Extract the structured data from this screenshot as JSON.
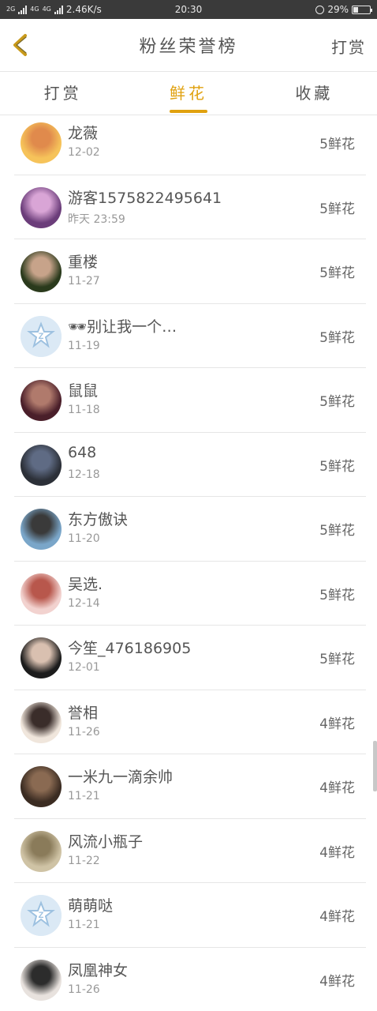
{
  "status_bar": {
    "net1": "2G",
    "net2": "4G",
    "net3": "4G",
    "speed": "2.46K/s",
    "time": "20:30",
    "battery_percent": "29%",
    "battery_level": 0.29
  },
  "header": {
    "title": "粉丝荣誉榜",
    "right_action": "打赏"
  },
  "tabs": [
    {
      "label": "打赏",
      "active": false
    },
    {
      "label": "鲜花",
      "active": true
    },
    {
      "label": "收藏",
      "active": false
    }
  ],
  "fans": [
    {
      "name": "龙薇",
      "time": "12-02",
      "flowers": "5鲜花",
      "avatar": "anime-avatar",
      "colors": [
        "#f6c35a",
        "#e08a4c"
      ]
    },
    {
      "name": "游客15758224956​41",
      "time": "昨天 23:59",
      "flowers": "5鲜花",
      "avatar": "anime-avatar",
      "colors": [
        "#6b3d7a",
        "#d9a5d6"
      ]
    },
    {
      "name": "重楼",
      "time": "11-27",
      "flowers": "5鲜花",
      "avatar": "photo-avatar",
      "colors": [
        "#2a3a1c",
        "#c7a38a"
      ]
    },
    {
      "name": "🕶别让我一个…",
      "time": "11-19",
      "flowers": "5鲜花",
      "avatar": "default-avatar",
      "colors": [
        "#dbe9f5",
        "#9dc1e0"
      ]
    },
    {
      "name": "鼠鼠",
      "time": "11-18",
      "flowers": "5鲜花",
      "avatar": "photo-avatar",
      "colors": [
        "#4a1f2a",
        "#b07a6c"
      ]
    },
    {
      "name": "648",
      "time": "12-18",
      "flowers": "5鲜花",
      "avatar": "photo-avatar",
      "colors": [
        "#2c3038",
        "#5f6b84"
      ]
    },
    {
      "name": "东方傲诀",
      "time": "11-20",
      "flowers": "5鲜花",
      "avatar": "photo-avatar",
      "colors": [
        "#7aa6c9",
        "#3a3a3a"
      ]
    },
    {
      "name": "吴选.",
      "time": "12-14",
      "flowers": "5鲜花",
      "avatar": "photo-avatar",
      "colors": [
        "#f2d2cf",
        "#b8574c"
      ]
    },
    {
      "name": "今笙_476186905",
      "time": "12-01",
      "flowers": "5鲜花",
      "avatar": "photo-avatar",
      "colors": [
        "#1c1c1c",
        "#d9c0b0"
      ]
    },
    {
      "name": "誉相",
      "time": "11-26",
      "flowers": "4鲜花",
      "avatar": "photo-avatar",
      "colors": [
        "#f0e6dc",
        "#3a2d2a"
      ]
    },
    {
      "name": "一米九一滴余帅",
      "time": "11-21",
      "flowers": "4鲜花",
      "avatar": "photo-avatar",
      "colors": [
        "#3b2c22",
        "#8a6a52"
      ]
    },
    {
      "name": "风流小瓶子",
      "time": "11-22",
      "flowers": "4鲜花",
      "avatar": "photo-avatar",
      "colors": [
        "#cfc3a5",
        "#8a7b5a"
      ]
    },
    {
      "name": "萌萌哒",
      "time": "11-21",
      "flowers": "4鲜花",
      "avatar": "default-avatar",
      "colors": [
        "#dbe9f5",
        "#9dc1e0"
      ]
    },
    {
      "name": "凤凰神女",
      "time": "11-26",
      "flowers": "4鲜花",
      "avatar": "photo-avatar",
      "colors": [
        "#e8e2de",
        "#2c2c2c"
      ]
    }
  ],
  "colors": {
    "accent": "#e0a10f",
    "divider": "#e6e6e6"
  }
}
